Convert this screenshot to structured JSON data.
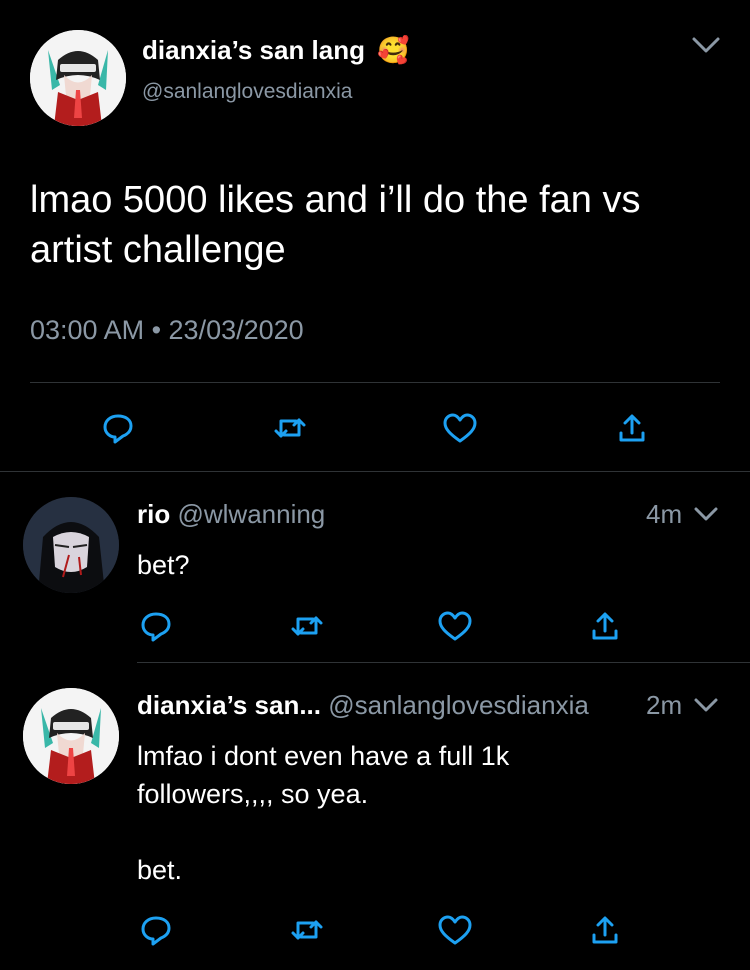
{
  "main_tweet": {
    "display_name": "dianxia’s san lang",
    "name_emoji": "🥰",
    "handle": "@sanlanglovesdianxia",
    "text_line1": "lmao 5000 likes and i’ll do the fan vs",
    "text_line2": "artist challenge",
    "timestamp": "03:00 AM • 23/03/2020"
  },
  "replies": [
    {
      "display_name": "rio",
      "handle": "@wlwanning",
      "time": "4m",
      "text_lines": [
        "bet?"
      ]
    },
    {
      "display_name": "dianxia’s san...",
      "handle": "@sanlanglovesdianxia",
      "time": "2m",
      "text_lines": [
        "lmfao i dont even have a full 1k",
        "followers,,,, so yea.",
        "",
        "bet."
      ]
    }
  ],
  "colors": {
    "background": "#000000",
    "text": "#ffffff",
    "muted": "#8b98a5",
    "icon": "#1da1f2",
    "divider": "#2f3336"
  }
}
